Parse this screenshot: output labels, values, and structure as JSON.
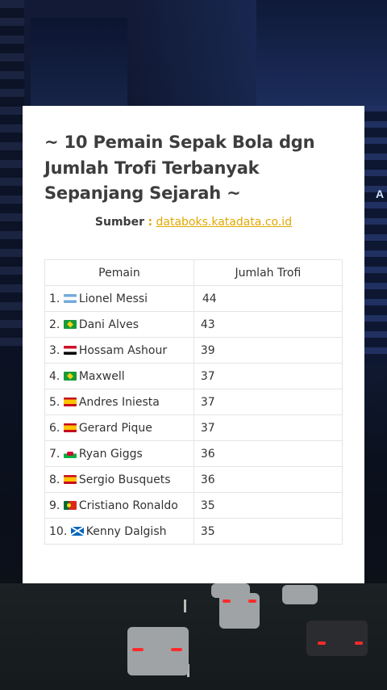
{
  "card": {
    "title": "~ 10 Pemain Sepak Bola dgn\nJumlah Trofi Terbanyak\nSepanjang Sejarah ~",
    "source_label": "Sumber",
    "source_colon": ":",
    "source_link": "databoks.katadata.co.id"
  },
  "table": {
    "headers": [
      "Pemain",
      "Jumlah Trofi"
    ],
    "rows": [
      {
        "rank": "1.",
        "flag": "argentina-flag-icon",
        "name": "Lionel Messi",
        "trophies": "44"
      },
      {
        "rank": "2.",
        "flag": "brazil-flag-icon",
        "name": "Dani Alves",
        "trophies": "43"
      },
      {
        "rank": "3.",
        "flag": "egypt-flag-icon",
        "name": "Hossam Ashour",
        "trophies": "39"
      },
      {
        "rank": "4.",
        "flag": "brazil-flag-icon",
        "name": "Maxwell",
        "trophies": "37"
      },
      {
        "rank": "5.",
        "flag": "spain-flag-icon",
        "name": "Andres Iniesta",
        "trophies": "37"
      },
      {
        "rank": "6.",
        "flag": "spain-flag-icon",
        "name": "Gerard Pique",
        "trophies": "37"
      },
      {
        "rank": "7.",
        "flag": "wales-flag-icon",
        "name": "Ryan Giggs",
        "trophies": "36"
      },
      {
        "rank": "8.",
        "flag": "spain-flag-icon",
        "name": "Sergio Busquets",
        "trophies": "36"
      },
      {
        "rank": "9.",
        "flag": "portugal-flag-icon",
        "name": "Cristiano Ronaldo",
        "trophies": "35"
      },
      {
        "rank": "10.",
        "flag": "scotland-flag-icon",
        "name": "Kenny Dalgish",
        "trophies": "35"
      }
    ]
  },
  "background": {
    "sign_text": "A"
  },
  "colors": {
    "title": "#3d3d3d",
    "link": "#e0a800",
    "card": "#ffffff",
    "grid": "#e4e4e4"
  }
}
